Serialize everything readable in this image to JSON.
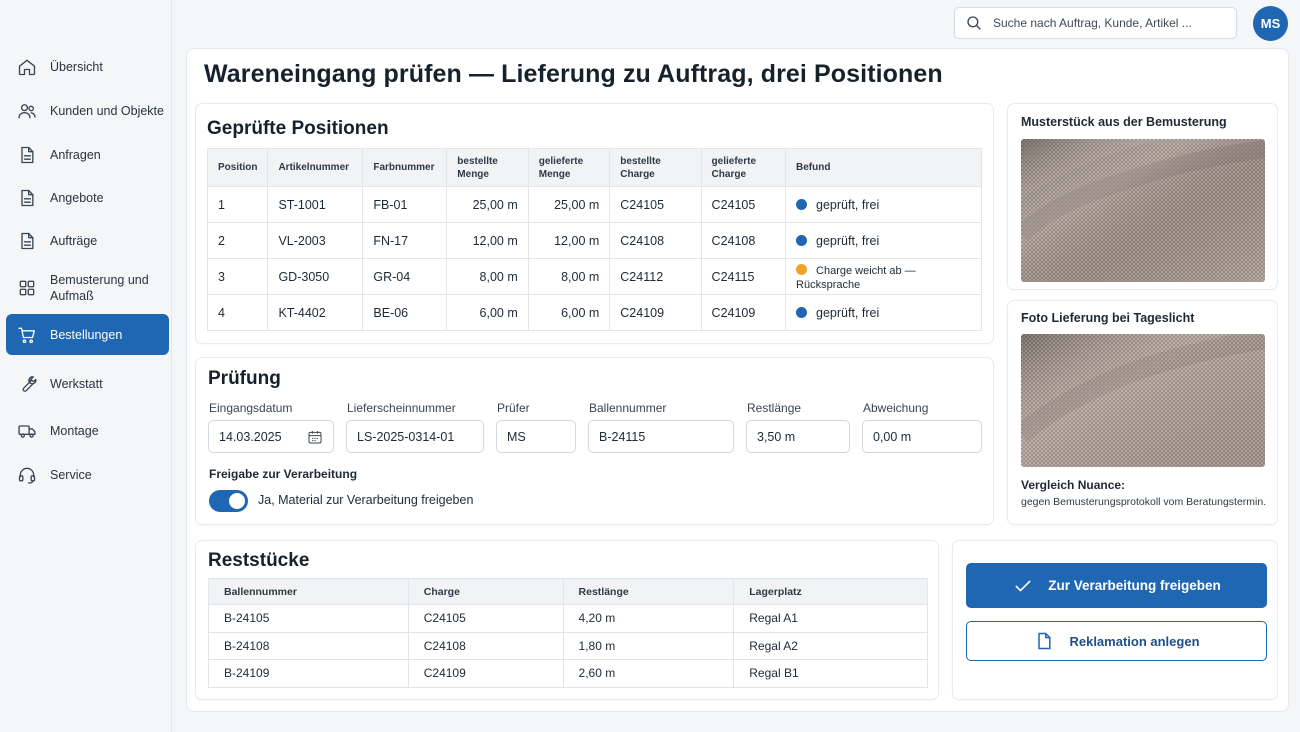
{
  "sidebar": {
    "items": [
      {
        "label": "Übersicht",
        "icon": "home-icon"
      },
      {
        "label": "Kunden und Objekte",
        "icon": "users-icon"
      },
      {
        "label": "Anfragen",
        "icon": "document-icon"
      },
      {
        "label": "Angebote",
        "icon": "document-icon"
      },
      {
        "label": "Aufträge",
        "icon": "document-icon"
      },
      {
        "label": "Bemusterung und Aufmaß",
        "icon": "grid-icon"
      },
      {
        "label": "Bestellungen",
        "icon": "cart-icon",
        "active": true
      },
      {
        "label": "Werkstatt",
        "icon": "wrench-icon"
      },
      {
        "label": "Montage",
        "icon": "truck-icon"
      },
      {
        "label": "Service",
        "icon": "headset-icon"
      }
    ]
  },
  "header": {
    "search_placeholder": "Suche nach Auftrag, Kunde, Artikel ...",
    "avatar_initials": "MS"
  },
  "page": {
    "title": "Wareneingang prüfen — Lieferung zu Auftrag, drei Positionen"
  },
  "positions": {
    "title": "Geprüfte Positionen",
    "columns": {
      "position": "Position",
      "artikel": "Artikelnummer",
      "farbe": "Farbnummer",
      "bestellt_menge": "bestellte Menge",
      "geliefert_menge": "gelieferte Menge",
      "bestellt_charge": "bestellte Charge",
      "geliefert_charge": "gelieferte Charge",
      "befund": "Befund"
    },
    "rows": [
      {
        "position": "1",
        "artikel": "ST-1001",
        "farbe": "FB-01",
        "bestellt_menge": "25,00 m",
        "geliefert_menge": "25,00 m",
        "bestellt_charge": "C24105",
        "geliefert_charge": "C24105",
        "befund": "geprüft, frei"
      },
      {
        "position": "2",
        "artikel": "VL-2003",
        "farbe": "FN-17",
        "bestellt_menge": "12,00 m",
        "geliefert_menge": "12,00 m",
        "bestellt_charge": "C24108",
        "geliefert_charge": "C24108",
        "befund": "geprüft, frei"
      },
      {
        "position": "3",
        "artikel": "GD-3050",
        "farbe": "GR-04",
        "bestellt_menge": "8,00 m",
        "geliefert_menge": "8,00 m",
        "bestellt_charge": "C24112",
        "geliefert_charge": "C24115",
        "befund": "Charge weicht ab — Rücksprache"
      },
      {
        "position": "4",
        "artikel": "KT-4402",
        "farbe": "BE-06",
        "bestellt_menge": "6,00 m",
        "geliefert_menge": "6,00 m",
        "bestellt_charge": "C24109",
        "geliefert_charge": "C24109",
        "befund": "geprüft, frei"
      }
    ],
    "status_colors": {
      "ok": "#1f66b3",
      "warn": "#f0a12a"
    }
  },
  "pruefung": {
    "title": "Prüfung",
    "fields": {
      "eingangsdatum": {
        "label": "Eingangsdatum",
        "value": "14.03.2025"
      },
      "lieferschein": {
        "label": "Lieferscheinnummer",
        "value": "LS-2025-0314-01"
      },
      "pruefer": {
        "label": "Prüfer",
        "value": "MS"
      },
      "ballen": {
        "label": "Ballennummer",
        "value": "B-24115"
      },
      "restlaenge": {
        "label": "Restlänge",
        "value": "3,50 m"
      },
      "abweichung": {
        "label": "Abweichung",
        "value": "0,00 m"
      }
    },
    "freigabe_label": "Freigabe zur Verarbeitung",
    "freigabe_toggle_label": "Ja, Material zur Verarbeitung freigeben"
  },
  "reststuecke": {
    "title": "Reststücke",
    "columns": {
      "ballen": "Ballennummer",
      "charge": "Charge",
      "restlaenge": "Restlänge",
      "lager": "Lagerplatz"
    },
    "rows": [
      {
        "ballen": "B-24105",
        "charge": "C24105",
        "restlaenge": "4,20 m",
        "lager": "Regal A1"
      },
      {
        "ballen": "B-24108",
        "charge": "C24108",
        "restlaenge": "1,80 m",
        "lager": "Regal A2"
      },
      {
        "ballen": "B-24109",
        "charge": "C24109",
        "restlaenge": "2,60 m",
        "lager": "Regal B1"
      }
    ]
  },
  "photos": {
    "muster_title": "Musterstück aus der Bemusterung",
    "lieferung_title": "Foto Lieferung bei Tageslicht",
    "vergleich_label": "Vergleich Nuance:",
    "vergleich_text": "gegen Bemusterungsprotokoll vom Beratungstermin."
  },
  "actions": {
    "freigeben": "Zur Verarbeitung freigeben",
    "reklamation": "Reklamation anlegen"
  },
  "colors": {
    "accent": "#1f66b3"
  }
}
